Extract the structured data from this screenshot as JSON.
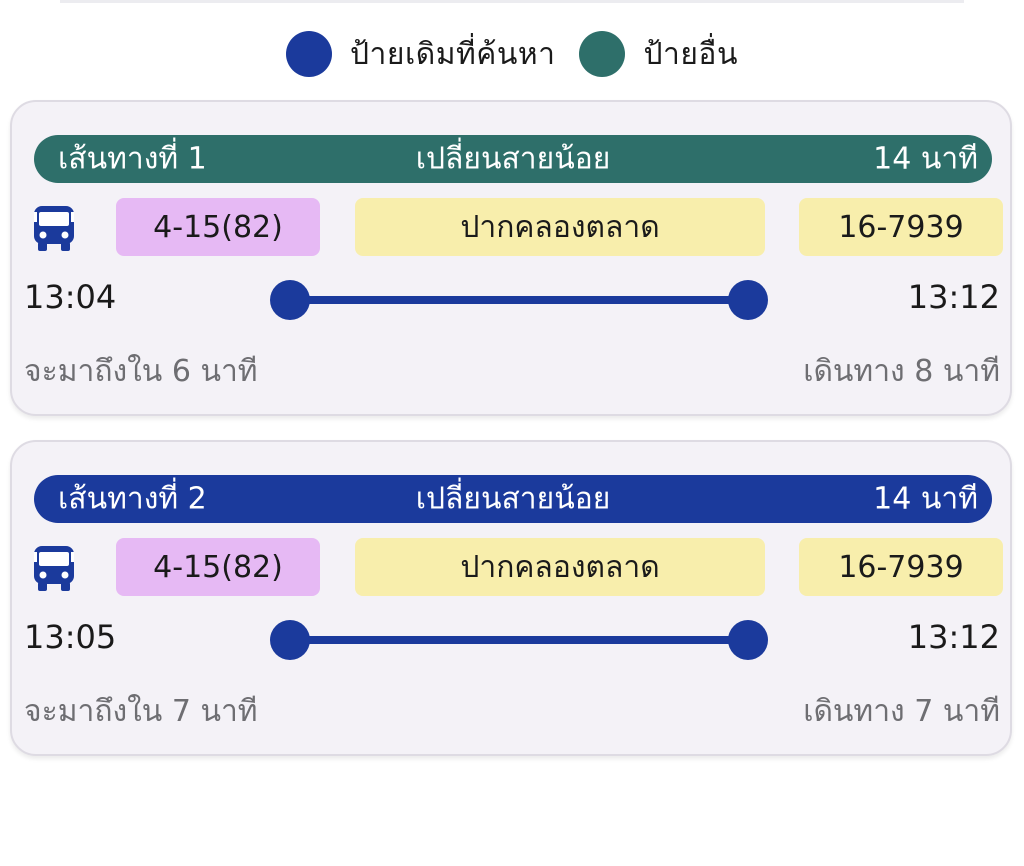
{
  "colors": {
    "original_stop": "#1b3a9c",
    "other_stop": "#2e6f6a",
    "route_chip": "#e6b9f4",
    "stop_chip": "#f8eeac"
  },
  "legend": {
    "original_label": "ป้ายเดิมที่ค้นหา",
    "other_label": "ป้ายอื่น"
  },
  "routes": [
    {
      "header_left": "เส้นทางที่ 1",
      "header_center": "เปลี่ยนสายน้อย",
      "header_right": "14 นาที",
      "header_color": "#2e6f6a",
      "icon": "bus-icon",
      "route_no": "4-15(82)",
      "stop_name": "ปากคลองตลาด",
      "plate": "16-7939",
      "depart_time": "13:04",
      "arrive_time": "13:12",
      "arrive_in": "จะมาถึงใน 6 นาที",
      "travel_time": "เดินทาง 8 นาที"
    },
    {
      "header_left": "เส้นทางที่ 2",
      "header_center": "เปลี่ยนสายน้อย",
      "header_right": "14 นาที",
      "header_color": "#1b3a9c",
      "icon": "bus-icon",
      "route_no": "4-15(82)",
      "stop_name": "ปากคลองตลาด",
      "plate": "16-7939",
      "depart_time": "13:05",
      "arrive_time": "13:12",
      "arrive_in": "จะมาถึงใน 7 นาที",
      "travel_time": "เดินทาง 7 นาที"
    }
  ]
}
